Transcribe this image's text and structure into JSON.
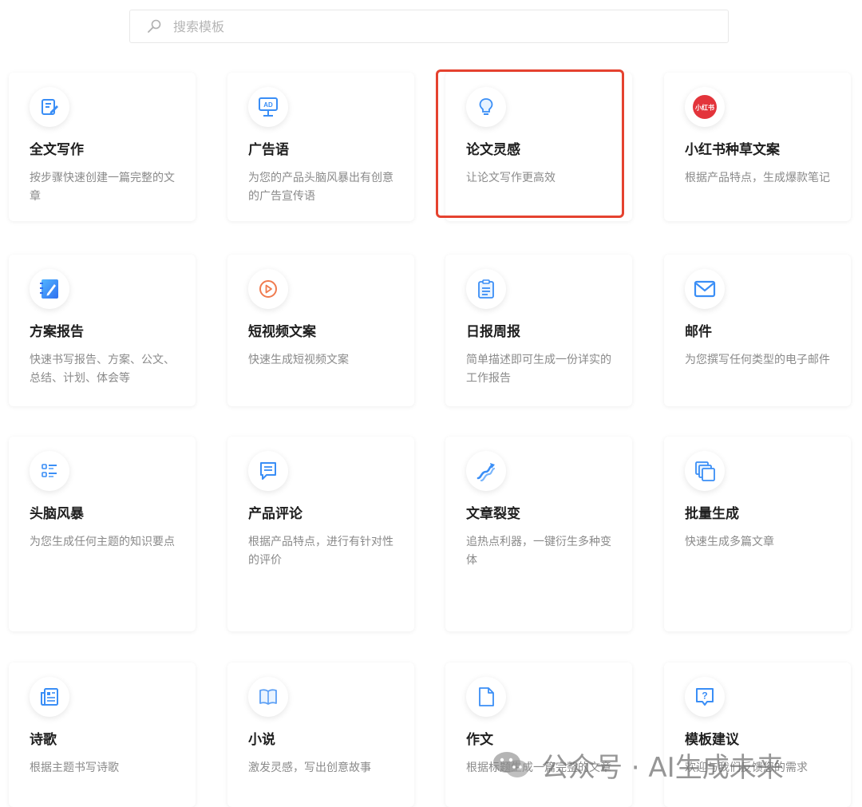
{
  "search": {
    "placeholder": "搜索模板"
  },
  "colors": {
    "highlight_border": "#e5422f",
    "title": "#1f1f1f",
    "desc": "#8a8a8a",
    "icon_blue": "#3a8ef6"
  },
  "cards": [
    {
      "title": "全文写作",
      "desc": "按步骤快速创建一篇完整的文章",
      "icon": "edit-icon"
    },
    {
      "title": "广告语",
      "desc": "为您的产品头脑风暴出有创意的广告宣传语",
      "icon": "ad-icon"
    },
    {
      "title": "论文灵感",
      "desc": "让论文写作更高效",
      "icon": "lightbulb-icon",
      "highlighted": true
    },
    {
      "title": "小红书种草文案",
      "desc": "根据产品特点，生成爆款笔记",
      "icon": "xiaohongshu-icon",
      "icon_text": "小红书"
    },
    {
      "title": "方案报告",
      "desc": "快速书写报告、方案、公文、总结、计划、体会等",
      "icon": "notebook-icon"
    },
    {
      "title": "短视频文案",
      "desc": "快速生成短视频文案",
      "icon": "play-icon"
    },
    {
      "title": "日报周报",
      "desc": "简单描述即可生成一份详实的工作报告",
      "icon": "clipboard-icon"
    },
    {
      "title": "邮件",
      "desc": "为您撰写任何类型的电子邮件",
      "icon": "mail-icon"
    },
    {
      "title": "头脑风暴",
      "desc": "为您生成任何主题的知识要点",
      "icon": "list-icon"
    },
    {
      "title": "产品评论",
      "desc": "根据产品特点，进行有针对性的评价",
      "icon": "comment-icon"
    },
    {
      "title": "文章裂变",
      "desc": "追热点利器，一键衍生多种变体",
      "icon": "split-arrow-icon"
    },
    {
      "title": "批量生成",
      "desc": "快速生成多篇文章",
      "icon": "stack-icon"
    },
    {
      "title": "诗歌",
      "desc": "根据主题书写诗歌",
      "icon": "newspaper-icon"
    },
    {
      "title": "小说",
      "desc": "激发灵感，写出创意故事",
      "icon": "book-icon"
    },
    {
      "title": "作文",
      "desc": "根据标题生成一篇完整的文章",
      "icon": "document-icon"
    },
    {
      "title": "模板建议",
      "desc": "欢迎与我们反馈您的需求",
      "icon": "question-icon"
    }
  ],
  "watermark": {
    "text": "公众号 · AI生成未来"
  }
}
